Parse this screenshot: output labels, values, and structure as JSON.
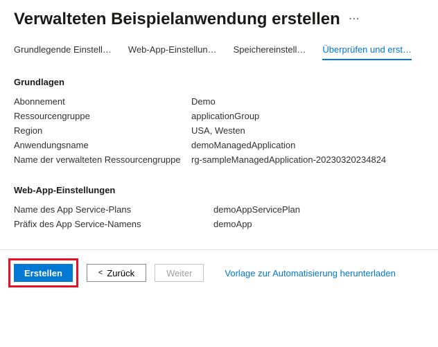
{
  "header": {
    "title": "Verwalteten Beispielanwendung erstellen",
    "more_label": "⋯"
  },
  "tabs": [
    {
      "label": "Grundlegende Einstell…"
    },
    {
      "label": "Web-App-Einstellun…"
    },
    {
      "label": "Speichereinstell…"
    },
    {
      "label": "Überprüfen und erst…"
    }
  ],
  "sections": {
    "basics": {
      "title": "Grundlagen",
      "rows": [
        {
          "label": "Abonnement",
          "value": "Demo"
        },
        {
          "label": "Ressourcengruppe",
          "value": "applicationGroup"
        },
        {
          "label": "Region",
          "value": "USA, Westen"
        },
        {
          "label": "Anwendungsname",
          "value": "demoManagedApplication"
        },
        {
          "label": "Name der verwalteten Ressourcengruppe",
          "value": "rg-sampleManagedApplication-20230320234824"
        }
      ]
    },
    "webapp": {
      "title": "Web-App-Einstellungen",
      "rows": [
        {
          "label": "Name des App Service-Plans",
          "value": "demoAppServicePlan"
        },
        {
          "label": "Präfix des App Service-Namens",
          "value": "demoApp"
        }
      ]
    }
  },
  "footer": {
    "create": "Erstellen",
    "back_chev": "<",
    "back": "Zurück",
    "next": "Weiter",
    "template_link": "Vorlage zur Automatisierung herunterladen"
  }
}
